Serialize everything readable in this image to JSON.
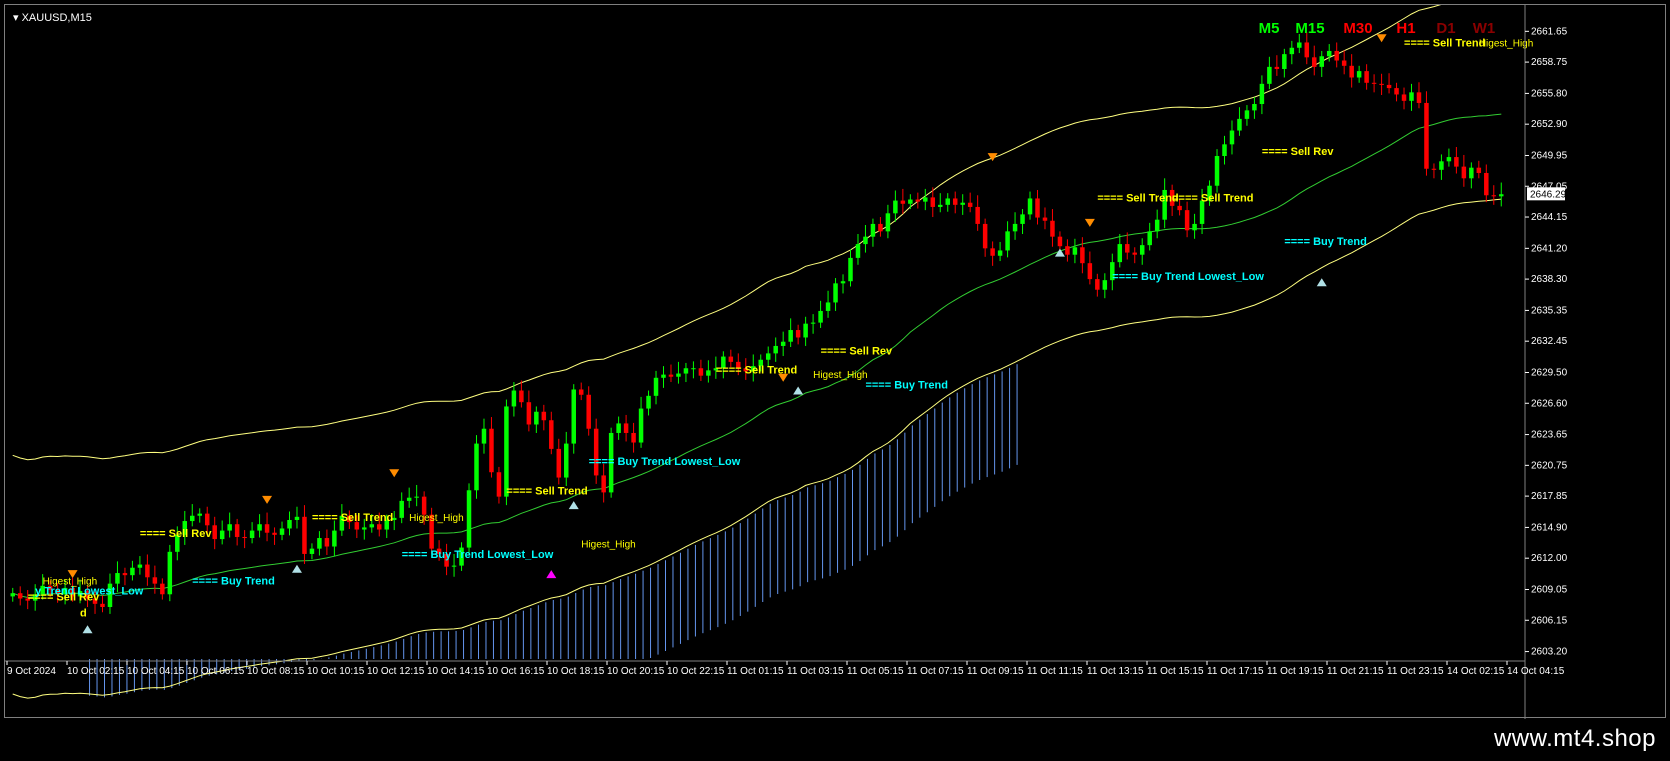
{
  "window": {
    "symbol": "XAUUSD,M15",
    "watermark": "www.mt4.shop"
  },
  "colors": {
    "bull": "#00ff00",
    "bear": "#ff0000",
    "ma_mid": "#32cd32",
    "band": "#ffff80",
    "cloud": "#6495ed",
    "sell_label": "#ffff00",
    "buy_label": "#00ffff",
    "arrow_up": "#b0e0e6",
    "arrow_down": "#ff8c00",
    "arrow_magenta": "#ff00ff"
  },
  "timeframes": [
    {
      "label": "M5",
      "color": "#00ff00"
    },
    {
      "label": "M15",
      "color": "#00ff00"
    },
    {
      "label": "M30",
      "color": "#ff0000"
    },
    {
      "label": "H1",
      "color": "#ff0000"
    },
    {
      "label": "D1",
      "color": "#8b0000"
    },
    {
      "label": "W1",
      "color": "#8b0000"
    }
  ],
  "chart_data": {
    "type": "candlestick",
    "title": "XAUUSD,M15",
    "ylim": [
      2602.5,
      2663.0
    ],
    "y_ticks": [
      "2661.65",
      "2658.75",
      "2655.80",
      "2652.90",
      "2649.95",
      "2647.05",
      "2644.15",
      "2641.20",
      "2638.30",
      "2635.35",
      "2632.45",
      "2629.50",
      "2626.60",
      "2623.65",
      "2620.75",
      "2617.85",
      "2614.90",
      "2612.00",
      "2609.05",
      "2606.15",
      "2603.20"
    ],
    "current_price": "2646.29",
    "x_ticks": [
      "9 Oct 2024",
      "10 Oct 02:15",
      "10 Oct 04:15",
      "10 Oct 06:15",
      "10 Oct 08:15",
      "10 Oct 10:15",
      "10 Oct 12:15",
      "10 Oct 14:15",
      "10 Oct 16:15",
      "10 Oct 18:15",
      "10 Oct 20:15",
      "10 Oct 22:15",
      "11 Oct 01:15",
      "11 Oct 03:15",
      "11 Oct 05:15",
      "11 Oct 07:15",
      "11 Oct 09:15",
      "11 Oct 11:15",
      "11 Oct 13:15",
      "11 Oct 15:15",
      "11 Oct 17:15",
      "11 Oct 19:15",
      "11 Oct 21:15",
      "11 Oct 23:15",
      "14 Oct 02:15",
      "14 Oct 04:15"
    ],
    "closes": [
      2608.7,
      2608.2,
      2608.0,
      2608.6,
      2609.4,
      2609.0,
      2608.6,
      2609.2,
      2608.4,
      2608.9,
      2608.2,
      2607.7,
      2607.4,
      2609.6,
      2610.6,
      2610.4,
      2611.1,
      2611.4,
      2610.2,
      2609.6,
      2608.6,
      2612.6,
      2614.2,
      2615.5,
      2616.0,
      2616.2,
      2615.1,
      2613.8,
      2614.6,
      2615.2,
      2614.0,
      2613.9,
      2614.6,
      2615.2,
      2614.4,
      2614.2,
      2614.8,
      2615.6,
      2615.9,
      2612.4,
      2612.9,
      2613.9,
      2613.1,
      2614.6,
      2616.0,
      2615.4,
      2614.7,
      2614.9,
      2615.2,
      2614.7,
      2615.6,
      2615.8,
      2617.4,
      2617.7,
      2617.8,
      2616.1,
      2612.9,
      2612.4,
      2611.2,
      2611.3,
      2613.0,
      2618.4,
      2622.8,
      2624.2,
      2620.1,
      2617.8,
      2626.3,
      2627.8,
      2626.7,
      2624.6,
      2625.8,
      2625.0,
      2622.3,
      2619.6,
      2622.8,
      2627.9,
      2627.4,
      2624.2,
      2619.8,
      2618.2,
      2623.8,
      2624.7,
      2623.8,
      2622.9,
      2626.1,
      2627.3,
      2629.0,
      2629.3,
      2629.1,
      2629.4,
      2629.9,
      2629.9,
      2629.2,
      2629.7,
      2629.9,
      2631.0,
      2630.5,
      2629.9,
      2629.6,
      2630.1,
      2630.7,
      2631.3,
      2632.0,
      2632.4,
      2633.5,
      2632.8,
      2634.1,
      2634.2,
      2635.3,
      2636.1,
      2637.9,
      2638.1,
      2640.3,
      2641.6,
      2642.3,
      2643.5,
      2642.8,
      2644.5,
      2645.7,
      2645.4,
      2645.8,
      2645.6,
      2646.0,
      2645.1,
      2645.3,
      2645.9,
      2645.3,
      2645.5,
      2645.1,
      2643.5,
      2641.2,
      2640.5,
      2641.0,
      2642.8,
      2643.5,
      2644.4,
      2645.9,
      2644.1,
      2643.8,
      2642.3,
      2641.4,
      2640.6,
      2641.3,
      2639.8,
      2638.3,
      2637.3,
      2638.2,
      2639.9,
      2641.6,
      2640.8,
      2640.6,
      2641.5,
      2642.8,
      2643.9,
      2646.7,
      2645.2,
      2644.8,
      2642.9,
      2643.5,
      2645.7,
      2647.1,
      2649.9,
      2651.0,
      2652.3,
      2653.4,
      2654.2,
      2654.8,
      2656.7,
      2658.3,
      2658.1,
      2659.5,
      2660.1,
      2660.6,
      2659.2,
      2658.3,
      2659.3,
      2659.8,
      2658.9,
      2658.4,
      2657.3,
      2657.9,
      2656.8,
      2656.7,
      2656.6,
      2656.3,
      2655.7,
      2655.1,
      2655.9,
      2654.9,
      2648.7,
      2648.6,
      2649.4,
      2649.8,
      2648.9,
      2647.8,
      2648.8,
      2648.3,
      2646.2,
      2646.1,
      2646.3
    ]
  },
  "signals": [
    {
      "text": "==== Sell Trend",
      "kind": "sell"
    },
    {
      "text": "Higest_High",
      "kind": "sell-sub"
    },
    {
      "text": "==== Sell Rev",
      "kind": "sell"
    },
    {
      "text": "==== Buy Trend",
      "kind": "buy"
    },
    {
      "text": "==== Buy Trend Lowest_Low",
      "kind": "buy"
    },
    {
      "text": "d",
      "kind": "sell"
    },
    {
      "text": "y Trend Lowest_Low",
      "kind": "buy"
    }
  ]
}
